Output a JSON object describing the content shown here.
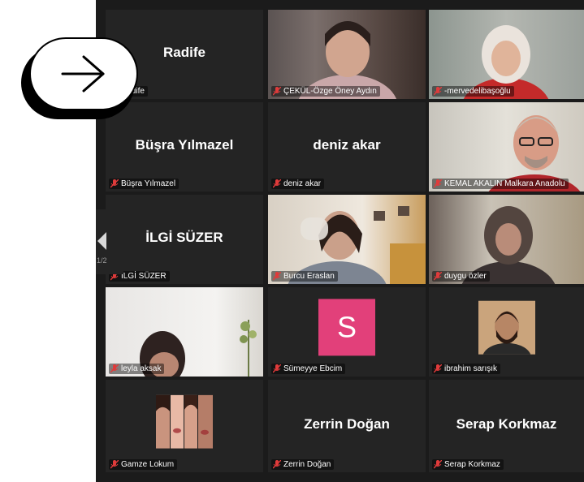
{
  "pager": {
    "label": "1/2"
  },
  "tiles": [
    {
      "center": "Radife",
      "footer": "Radife"
    },
    {
      "footer": "ÇEKÜL-Özge Öney Aydın"
    },
    {
      "footer": "-mervedelibaşoğlu"
    },
    {
      "center": "Büşra Yılmazel",
      "footer": "Büşra Yılmazel"
    },
    {
      "center": "deniz akar",
      "footer": "deniz akar"
    },
    {
      "footer": "KEMAL AKALIN Malkara Anadolu"
    },
    {
      "center": "İLGİ SÜZER",
      "footer": "İLGİ SÜZER"
    },
    {
      "footer": "Burcu Eraslan"
    },
    {
      "footer": "duygu özler"
    },
    {
      "footer": "leyla aksak"
    },
    {
      "footer": "Sümeyye Ebcim",
      "avatar": "S"
    },
    {
      "footer": "ibrahim sarışık"
    },
    {
      "footer": "Gamze Lokum"
    },
    {
      "center": "Zerrin Doğan",
      "footer": "Zerrin Doğan"
    },
    {
      "center": "Serap Korkmaz",
      "footer": "Serap Korkmaz"
    }
  ],
  "colors": {
    "mic_muted": "#e03b3b",
    "avatar_bg": "#e2407a",
    "tile_bg": "#242424"
  },
  "icons": {
    "mic": "microphone-muted-icon",
    "arrow": "arrow-right-icon",
    "pager": "chevron-left-icon"
  }
}
